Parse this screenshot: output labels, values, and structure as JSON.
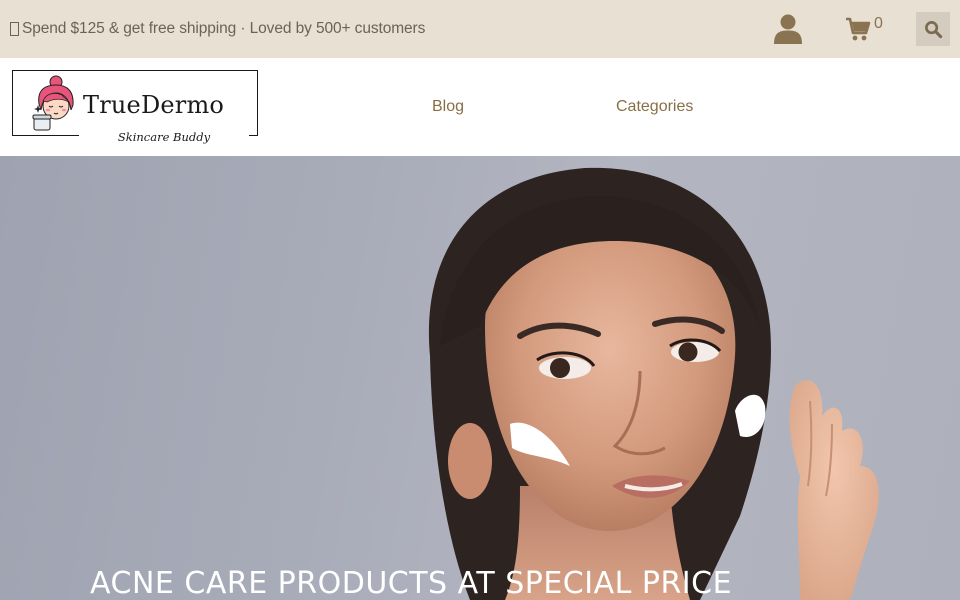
{
  "topbar": {
    "promo_text": "Spend $125 & get free shipping · Loved by 500+ customers",
    "cart_count": "0"
  },
  "brand": {
    "name": "TrueDermo",
    "tagline": "Skincare Buddy"
  },
  "nav": {
    "items": [
      {
        "label": "Blog"
      },
      {
        "label": "Categories"
      }
    ]
  },
  "hero": {
    "headline": "ACNE CARE PRODUCTS AT SPECIAL PRICE"
  },
  "colors": {
    "topbar_bg": "#e9e0d4",
    "nav_text": "#8a6e45",
    "icon_brown": "#8a7350",
    "search_bg": "#d5ccc0"
  },
  "icons": {
    "account": "account-icon",
    "cart": "cart-icon",
    "search": "search-icon"
  }
}
